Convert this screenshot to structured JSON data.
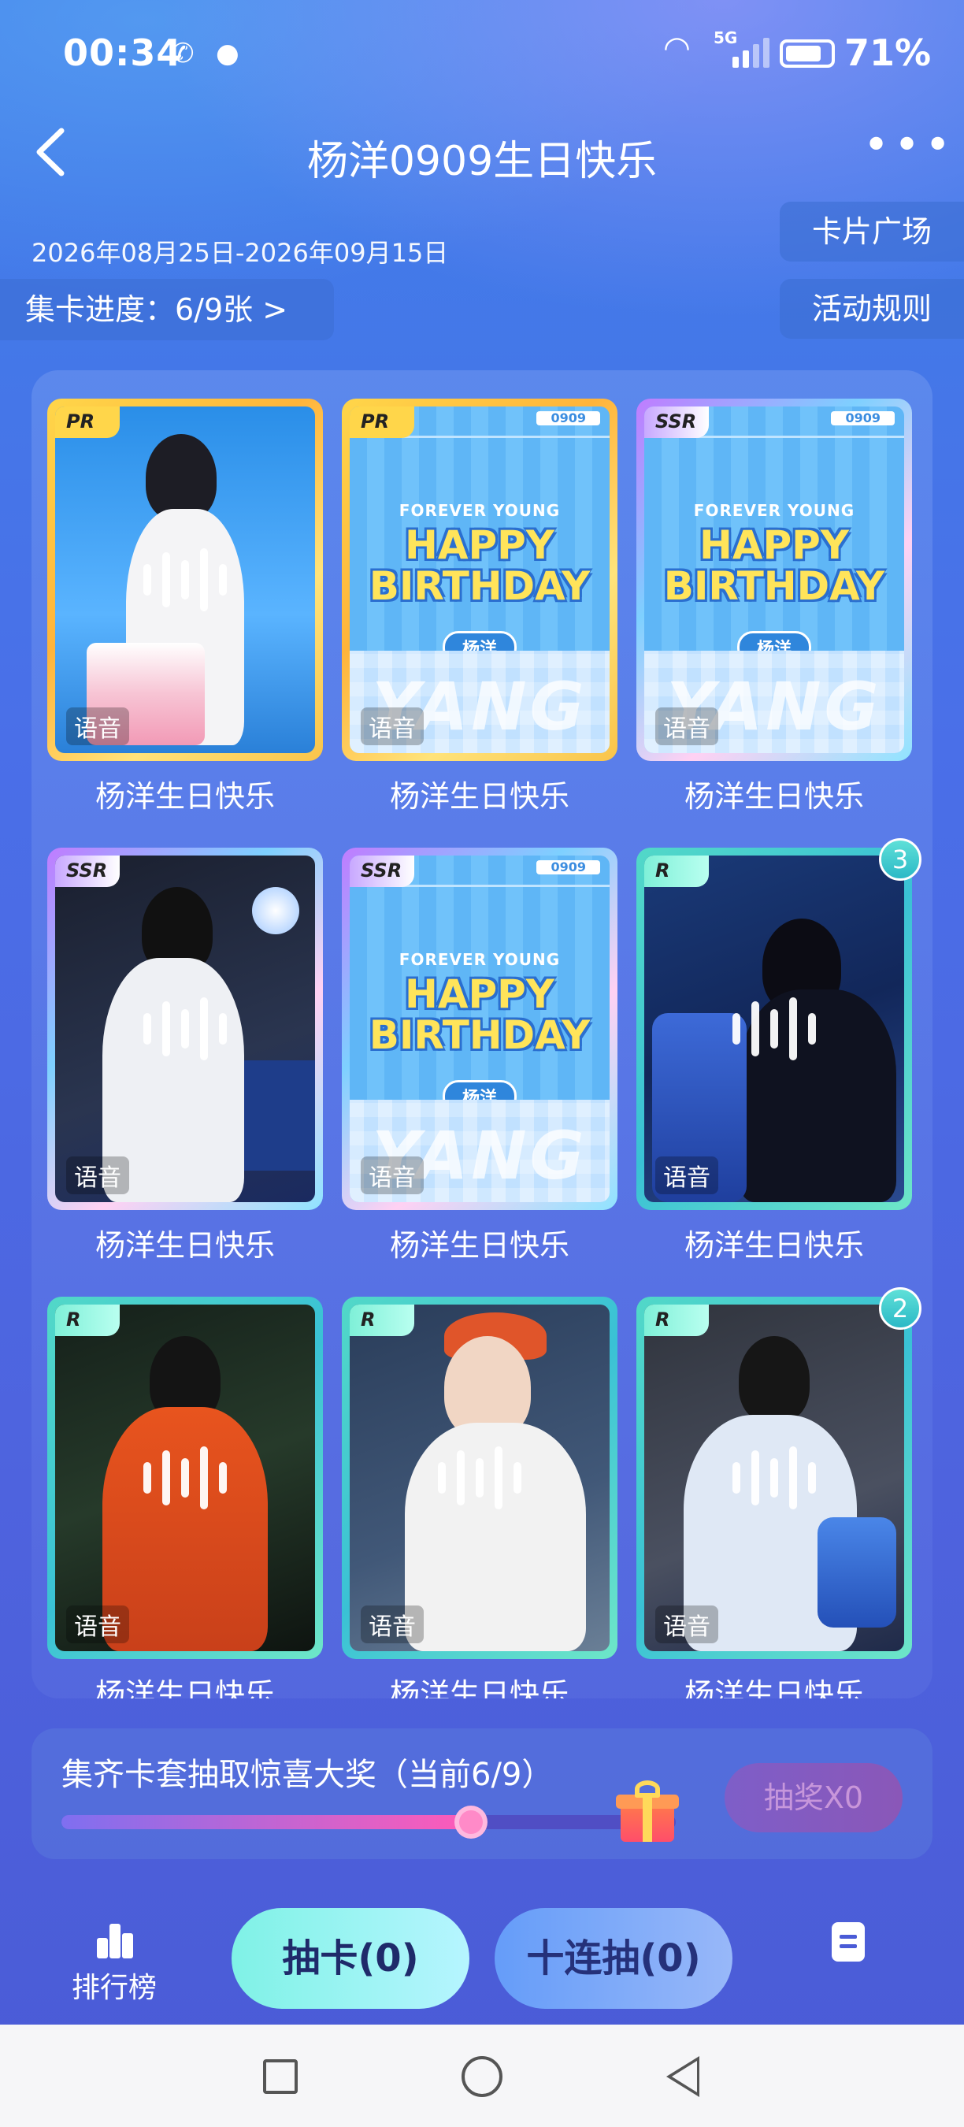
{
  "status_bar": {
    "time": "00:34",
    "network": "5G",
    "battery": "71%"
  },
  "header": {
    "title": "杨洋0909生日快乐"
  },
  "event": {
    "date_range": "2026年08月25日-2026年09月15日",
    "progress_label": "集卡进度：6/9张 >",
    "card_plaza": "卡片广场",
    "rules": "活动规则"
  },
  "cards": [
    {
      "rarity": "PR",
      "name": "杨洋生日快乐",
      "voice": "语音",
      "style": "photo-cake",
      "count": ""
    },
    {
      "rarity": "PR",
      "name": "杨洋生日快乐",
      "voice": "语音",
      "style": "birthday",
      "count": ""
    },
    {
      "rarity": "SSR",
      "name": "杨洋生日快乐",
      "voice": "语音",
      "style": "birthday",
      "count": ""
    },
    {
      "rarity": "SSR",
      "name": "杨洋生日快乐",
      "voice": "语音",
      "style": "photo-pray-dark",
      "count": ""
    },
    {
      "rarity": "SSR",
      "name": "杨洋生日快乐",
      "voice": "语音",
      "style": "birthday",
      "count": ""
    },
    {
      "rarity": "R",
      "name": "杨洋生日快乐",
      "voice": "语音",
      "style": "photo-blue",
      "count": "3"
    },
    {
      "rarity": "R",
      "name": "杨洋生日快乐",
      "voice": "语音",
      "style": "photo-orange",
      "count": ""
    },
    {
      "rarity": "R",
      "name": "杨洋生日快乐",
      "voice": "语音",
      "style": "photo-white",
      "count": ""
    },
    {
      "rarity": "R",
      "name": "杨洋生日快乐",
      "voice": "语音",
      "style": "photo-pray-light",
      "count": "2"
    }
  ],
  "birthday_card": {
    "tag": "0909",
    "forever": "FOREVER YOUNG",
    "happy": "HAPPY",
    "birthday": "BIRTHDAY",
    "name": "杨洋",
    "yang": "YANG"
  },
  "prize": {
    "text": "集齐卡套抽取惊喜大奖（当前6/9）",
    "progress": 0.667,
    "draw_label": "抽奖X0"
  },
  "bottom": {
    "ranking": "排行榜",
    "draw": "抽卡(0)",
    "ten_draw": "十连抽(0)"
  },
  "colors": {
    "accent": "#4e63de",
    "pr": "#ffd64a",
    "r": "#52d8c8",
    "draw_button": "#7ff2e6"
  }
}
